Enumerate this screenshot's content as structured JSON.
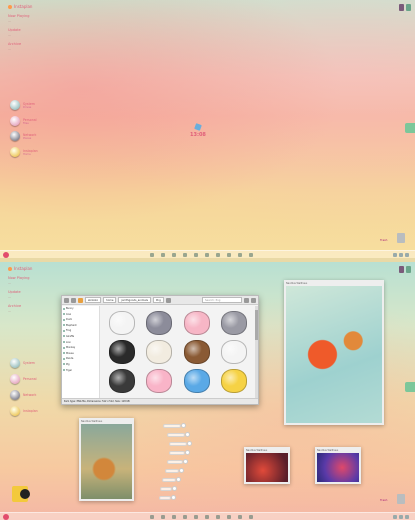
{
  "widget": {
    "title": "Instaplan",
    "sections": [
      {
        "label": "Now Playing",
        "sub": "—"
      },
      {
        "label": "Update",
        "sub": "—"
      },
      {
        "label": "Archive",
        "sub": "—"
      }
    ]
  },
  "dock": [
    {
      "icon": "computer-icon",
      "label": "System",
      "sub": "Drives"
    },
    {
      "icon": "documents-icon",
      "label": "Personal",
      "sub": "Files"
    },
    {
      "icon": "network-icon",
      "label": "Network",
      "sub": "Places"
    },
    {
      "icon": "user-icon",
      "label": "Instaplan",
      "sub": "Home"
    }
  ],
  "clock": {
    "time": "13:08"
  },
  "trash": {
    "label": "Trash"
  },
  "file_manager": {
    "crumbs": [
      "sbrkoko",
      "home",
      "jsmthgoods_animals",
      "Png"
    ],
    "search_placeholder": "Search: Png",
    "sidebar": [
      "Bunny",
      "Cow",
      "Duck",
      "Elephant",
      "Frog",
      "Giraffe",
      "Lion",
      "Monkey",
      "Mouse",
      "Panda",
      "Pig",
      "Tiger"
    ],
    "status": "Item type: PNG file, Dimensions: 512 x 512, Size: 118 KB",
    "size": "118 KB",
    "icons": [
      {
        "name": "panda",
        "color": "#f4f4f4"
      },
      {
        "name": "elephant",
        "color": "#8c8c9a"
      },
      {
        "name": "pig",
        "color": "#f7b6c6"
      },
      {
        "name": "hippo",
        "color": "#9a9aa4"
      },
      {
        "name": "penguin",
        "color": "#2a2a2a"
      },
      {
        "name": "sheep",
        "color": "#f2ece0"
      },
      {
        "name": "bear",
        "color": "#8a5a34"
      },
      {
        "name": "cow",
        "color": "#f4f4f4"
      },
      {
        "name": "cat",
        "color": "#3a3a3a"
      },
      {
        "name": "piglet",
        "color": "#f9b4c8"
      },
      {
        "name": "bird",
        "color": "#5aa9e6"
      },
      {
        "name": "chicken",
        "color": "#f6d245"
      }
    ]
  },
  "photos": [
    {
      "title": "Nautilus Wallhaus"
    },
    {
      "title": "Nautilus Wallhaus"
    },
    {
      "title": "Nautilus Wallhaus"
    },
    {
      "title": "Nautilus Wallhaus"
    }
  ]
}
